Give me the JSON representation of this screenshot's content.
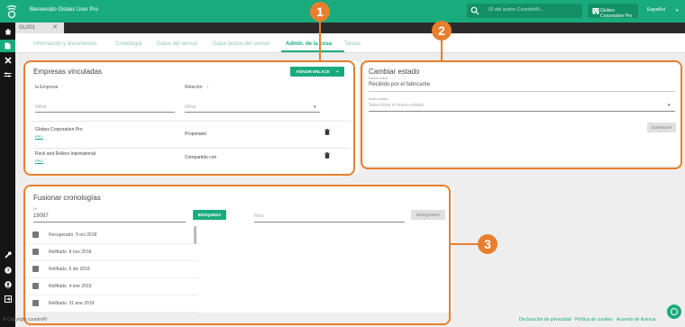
{
  "header": {
    "welcome": "Bienvenido Globes User Pro",
    "search_placeholder": "ID del activo Countrol®...",
    "company": "Globes Corporation Pro",
    "language": "Español",
    "language_caret": "▾"
  },
  "tab": {
    "label": "GL001",
    "close": "✕"
  },
  "subnav": {
    "items": [
      "Información y documentos",
      "Cronología",
      "Datos del sensor",
      "Datos brutos del sensor",
      "Admin. de la cosa",
      "Tareas"
    ]
  },
  "linked": {
    "title": "Empresas vinculadas",
    "add_button": "AÑADIR ENLACE",
    "add_button_icon": "+",
    "col_company": "la Empresa",
    "col_relation": "Relación",
    "filter_company": "Filtrar",
    "filter_relation": "Filtrar",
    "sort_arrow": "↑",
    "dropdown_caret": "▾",
    "rows": [
      {
        "company": "Globes Corporation Pro",
        "badge": "PRO",
        "relation": "Propietario"
      },
      {
        "company": "Rock and Rollers International",
        "badge": "PRO",
        "relation": "Compartido con"
      }
    ]
  },
  "status": {
    "title": "Cambiar estado",
    "current_label": "Estado actual",
    "current_value": "Recibido por el fabricante",
    "new_label": "Nuevo estado",
    "new_placeholder": "Seleccione el nuevo estado",
    "dropdown_caret": "▾",
    "save_button": "GUARDAR"
  },
  "merge": {
    "title": "Fusionar cronologías",
    "from_label": "De",
    "from_value": "19097",
    "search_button": "BÚSQUEDA",
    "to_placeholder": "Para",
    "search_button_disabled": "BÚSQUEDA",
    "events": [
      {
        "status": "Recuperado",
        "date": "9 oct 2018"
      },
      {
        "status": "Rellñado",
        "date": "8 nov 2018"
      },
      {
        "status": "Rellñado",
        "date": "6 dic 2018"
      },
      {
        "status": "Rellñado",
        "date": "4 ene 2019"
      },
      {
        "status": "Rellñado",
        "date": "31 ene 2019"
      }
    ]
  },
  "callouts": [
    "1",
    "2",
    "3"
  ],
  "footer": {
    "copyright": "© Copyright countrol®",
    "links": "Declaración de privacidad · Política de cookies · Acuerdo de licencia"
  },
  "colors": {
    "brand": "#1aab7c",
    "callout": "#e77f2e",
    "sidebar": "#151515"
  }
}
